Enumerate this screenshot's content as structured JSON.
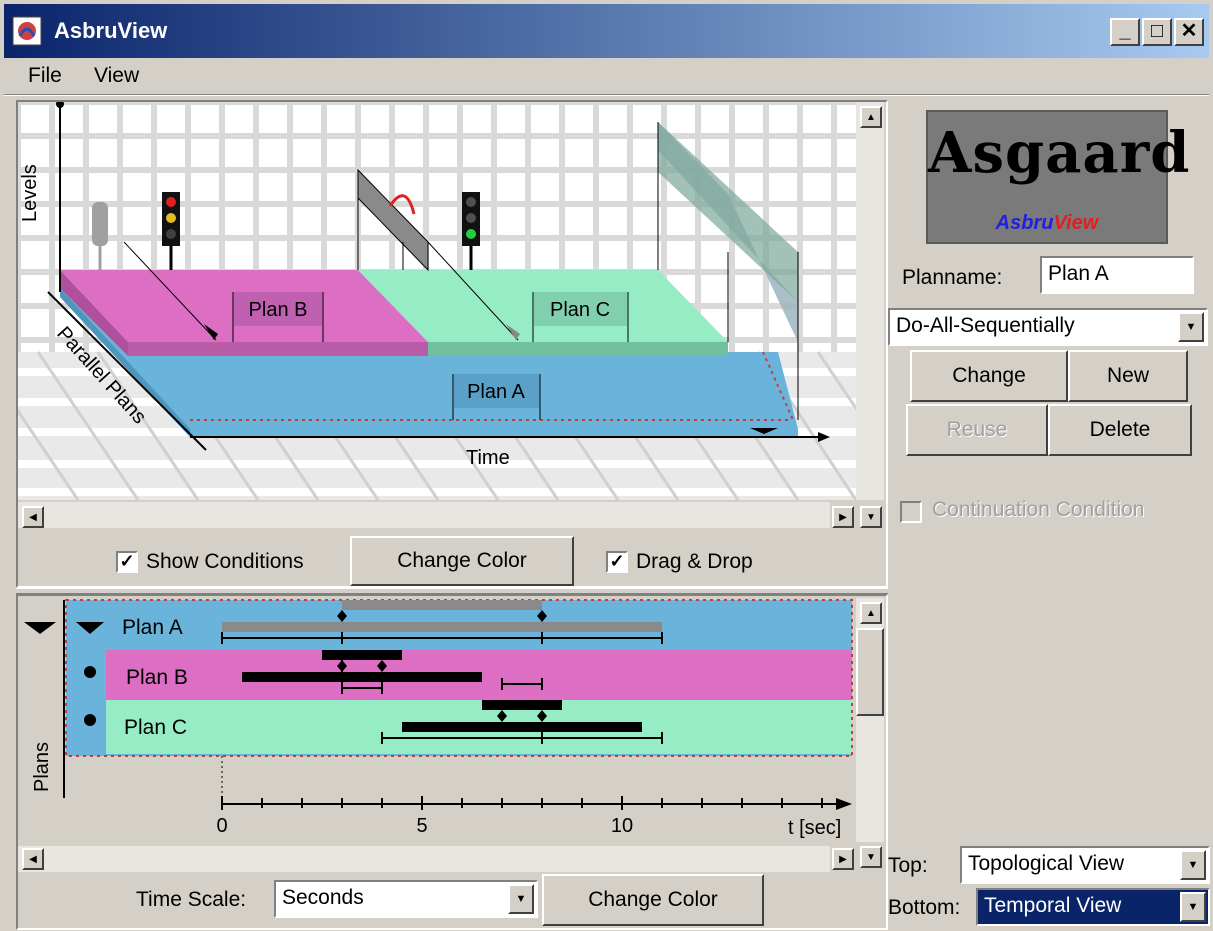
{
  "window": {
    "title": "AsbruView"
  },
  "menu": {
    "file": "File",
    "view": "View"
  },
  "topology": {
    "axis_levels": "Levels",
    "axis_parallel": "Parallel Plans",
    "axis_time": "Time",
    "plan_a": "Plan A",
    "plan_b": "Plan B",
    "plan_c": "Plan C"
  },
  "top_controls": {
    "show_conditions": "Show Conditions",
    "show_conditions_checked": true,
    "change_color": "Change Color",
    "drag_drop": "Drag & Drop",
    "drag_drop_checked": true
  },
  "temporal": {
    "axis_plans": "Plans",
    "axis_time_unit": "t [sec]",
    "ticks": [
      "0",
      "5",
      "10"
    ],
    "rows": [
      {
        "label": "Plan A",
        "color": "#6ab4dc"
      },
      {
        "label": "Plan B",
        "color": "#dc6ec4"
      },
      {
        "label": "Plan C",
        "color": "#96ecc4"
      }
    ]
  },
  "bottom_controls": {
    "time_scale_label": "Time Scale:",
    "time_scale_value": "Seconds",
    "change_color": "Change Color"
  },
  "side": {
    "logo_title": "Asgaard",
    "logo_sub_a": "Asbru",
    "logo_sub_b": "View",
    "planname_label": "Planname:",
    "planname_value": "Plan A",
    "mode_value": "Do-All-Sequentially",
    "change": "Change",
    "new": "New",
    "reuse": "Reuse",
    "delete": "Delete",
    "continuation": "Continuation Condition",
    "top_label": "Top:",
    "top_value": "Topological View",
    "bottom_label": "Bottom:",
    "bottom_value": "Temporal View"
  },
  "colors": {
    "plan_a": "#6ab4dc",
    "plan_b": "#dc6ec4",
    "plan_c": "#96ecc4",
    "selection": "#0a246a"
  }
}
